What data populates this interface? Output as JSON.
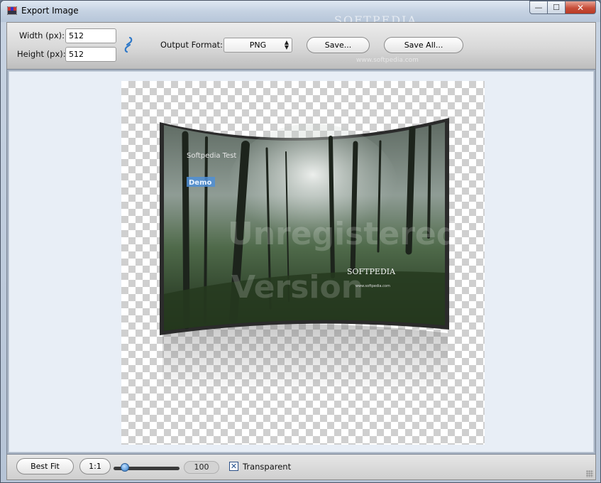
{
  "window": {
    "title": "Export Image",
    "watermark": "SOFTPEDIA",
    "watermark_url": "www.softpedia.com",
    "controls": {
      "minimize": "—",
      "maximize": "☐",
      "close": "✕"
    }
  },
  "toolbar": {
    "width_label": "Width (px):",
    "width_value": "512",
    "height_label": "Height (px):",
    "height_value": "512",
    "link_icon": "chain-link-icon",
    "output_format_label": "Output Format:",
    "output_format_value": "PNG",
    "save_label": "Save...",
    "save_all_label": "Save All..."
  },
  "preview": {
    "overlay_title": "Softpedia Test",
    "overlay_badge": "Demo",
    "watermark_line1": "Unregistered",
    "watermark_line2": "Version",
    "logo_text": "SOFTPEDIA",
    "logo_url": "www.softpedia.com"
  },
  "statusbar": {
    "best_fit_label": "Best Fit",
    "one_to_one_label": "1:1",
    "zoom_value": "100",
    "zoom_level": 0.17,
    "transparent_label": "Transparent",
    "transparent_checked": true
  },
  "colors": {
    "accent": "#2e78c8",
    "close_button": "#c74e3a"
  }
}
